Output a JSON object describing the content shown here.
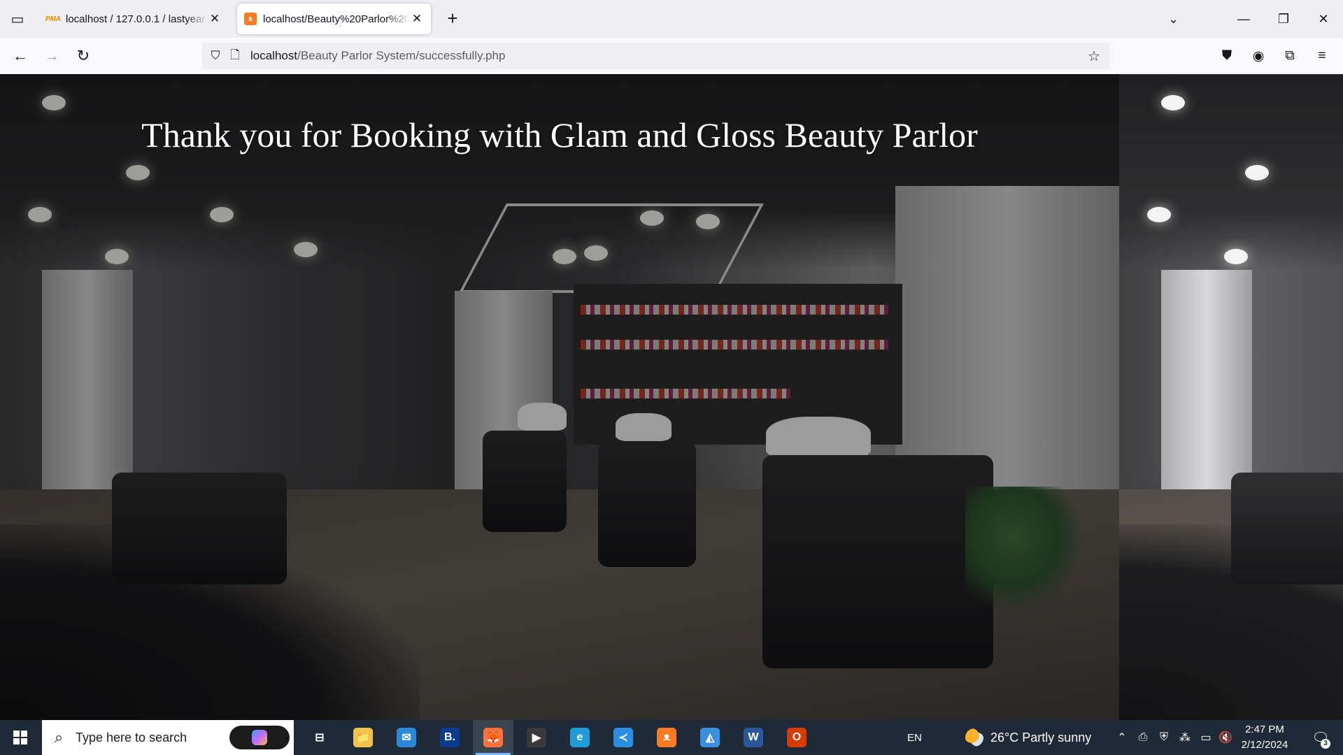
{
  "browser": {
    "tabs": [
      {
        "title": "localhost / 127.0.0.1 / lastyear / ",
        "favicon": "phpmyadmin-icon",
        "favicon_text": "PMA",
        "active": false
      },
      {
        "title": "localhost/Beauty%20Parlor%20",
        "favicon": "xampp-icon",
        "active": true
      }
    ],
    "new_tab_icon": "plus-icon",
    "url": {
      "host": "localhost",
      "path": "/Beauty Parlor System/successfully.php"
    },
    "window_controls": [
      "minimize-icon",
      "restore-icon",
      "close-icon"
    ]
  },
  "page": {
    "heading": "Thank you for Booking with Glam and Gloss Beauty Parlor",
    "background": "salon-interior-photo"
  },
  "taskbar": {
    "search_placeholder": "Type here to search",
    "pinned_apps": [
      {
        "name": "task-view",
        "glyph": "⊟"
      },
      {
        "name": "file-explorer",
        "glyph": "📁",
        "color": "#f2c14e"
      },
      {
        "name": "mail",
        "glyph": "✉",
        "color": "#2b88d8"
      },
      {
        "name": "booking",
        "glyph": "B.",
        "color": "#0b3b8f"
      },
      {
        "name": "firefox",
        "glyph": "🦊",
        "color": "#ff7139",
        "active": true
      },
      {
        "name": "media-player",
        "glyph": "▶",
        "color": "#3a3a3a"
      },
      {
        "name": "edge",
        "glyph": "e",
        "color": "#1f9bd8"
      },
      {
        "name": "vscode",
        "glyph": "≺",
        "color": "#2a8fe0"
      },
      {
        "name": "xampp",
        "glyph": "ᴥ",
        "color": "#fb7a24"
      },
      {
        "name": "photos",
        "glyph": "◭",
        "color": "#3a8fde"
      },
      {
        "name": "word",
        "glyph": "W",
        "color": "#2b579a"
      },
      {
        "name": "office",
        "glyph": "O",
        "color": "#d83b01"
      }
    ],
    "language": "EN",
    "weather": {
      "temp": "26°C",
      "condition": "Partly sunny"
    },
    "clock": {
      "time": "2:47 PM",
      "date": "2/12/2024"
    },
    "notification_count": "3"
  }
}
